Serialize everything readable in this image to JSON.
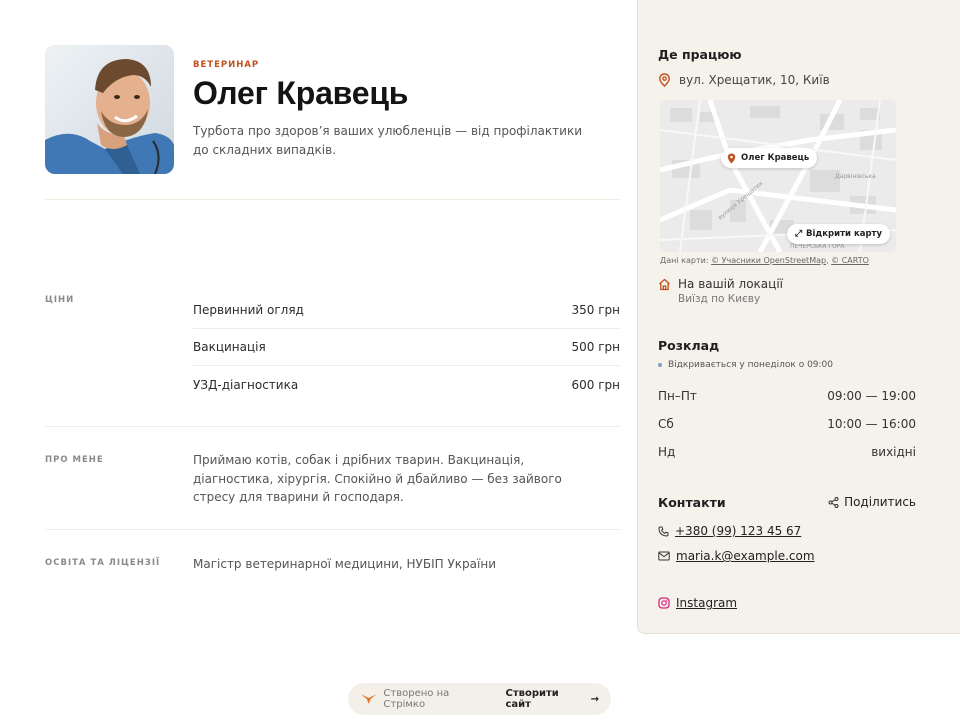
{
  "profile": {
    "profession": "ВЕТЕРИНАР",
    "name": "Олег Кравець",
    "tagline": "Турбота про здоров’я ваших улюбленців — від профілактики до складних випадків."
  },
  "prices": {
    "label": "ЦІНИ",
    "items": [
      {
        "name": "Первинний огляд",
        "price": "350 грн"
      },
      {
        "name": "Вакцинація",
        "price": "500 грн"
      },
      {
        "name": "УЗД-діагностика",
        "price": "600 грн"
      }
    ]
  },
  "about": {
    "label": "ПРО МЕНЕ",
    "text": "Приймаю котів, собак і дрібних тварин. Вакцинація, діагностика, хірургія. Спокійно й дбайливо — без зайвого стресу для тварини й господаря."
  },
  "education": {
    "label": "ОСВІТА ТА ЛІЦЕНЗІЇ",
    "text": "Магістр ветеринарної медицини, НУБІП України"
  },
  "sidebar": {
    "where_title": "Де працюю",
    "address": "вул. Хрещатик, 10, Київ",
    "map_pin_label": "Олег Кравець",
    "map_open_label": "Відкрити карту",
    "map_credit_prefix": "Дані карти: ",
    "map_credit_osm": "© Учасники OpenStreetMap",
    "map_credit_sep": ", ",
    "map_credit_carto": "© CARTO",
    "location_title": "На вашій локації",
    "location_sub": "Виїзд по Києву",
    "schedule_title": "Розклад",
    "schedule_status": "Відкривається у понеділок о 09:00",
    "schedule": [
      {
        "days": "Пн–Пт",
        "hours": "09:00 — 19:00"
      },
      {
        "days": "Сб",
        "hours": "10:00 — 16:00"
      },
      {
        "days": "Нд",
        "hours": "вихідні"
      }
    ],
    "contacts_title": "Контакти",
    "share_label": "Поділитись",
    "phone": "+380 (99) 123 45 67",
    "email": "maria.k@example.com",
    "instagram": "Instagram"
  },
  "footer": {
    "made_with": "Створено на Стрімко",
    "cta": "Створити сайт",
    "cta_arrow": "→"
  },
  "colors": {
    "accent": "#c0501c",
    "sidebar_bg": "#f5f2ec",
    "instagram": "#d6247a"
  },
  "icons": [
    "map-pin-icon",
    "home-icon",
    "phone-icon",
    "mail-icon",
    "instagram-icon",
    "share-icon",
    "expand-icon",
    "logo-icon",
    "arrow-right-icon"
  ]
}
